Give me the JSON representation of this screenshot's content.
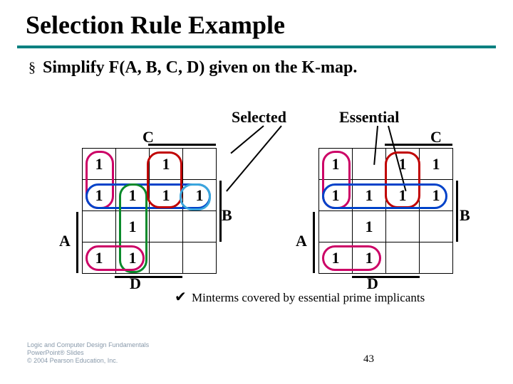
{
  "title": "Selection Rule Example",
  "bullet": {
    "glyph": "§",
    "text": "Simplify F(A, B, C, D) given on the K-map."
  },
  "labels": {
    "selected": "Selected",
    "essential": "Essential",
    "A": "A",
    "B": "B",
    "C": "C",
    "D": "D"
  },
  "kmap_left": [
    [
      "1",
      "",
      "1",
      ""
    ],
    [
      "1",
      "1",
      "1",
      "1"
    ],
    [
      "",
      "1",
      "",
      ""
    ],
    [
      "1",
      "1",
      "",
      ""
    ]
  ],
  "kmap_right": [
    [
      "1",
      "",
      "1",
      "1"
    ],
    [
      "1",
      "1",
      "1",
      "1"
    ],
    [
      "",
      "1",
      "",
      ""
    ],
    [
      "1",
      "1",
      "",
      ""
    ]
  ],
  "footer": {
    "check": "✔",
    "text": "Minterms covered by essential prime implicants"
  },
  "page_number": "43",
  "copyright": {
    "line1": "Logic and Computer Design Fundamentals",
    "line2": "PowerPoint® Slides",
    "line3": "© 2004 Pearson Education, Inc."
  }
}
